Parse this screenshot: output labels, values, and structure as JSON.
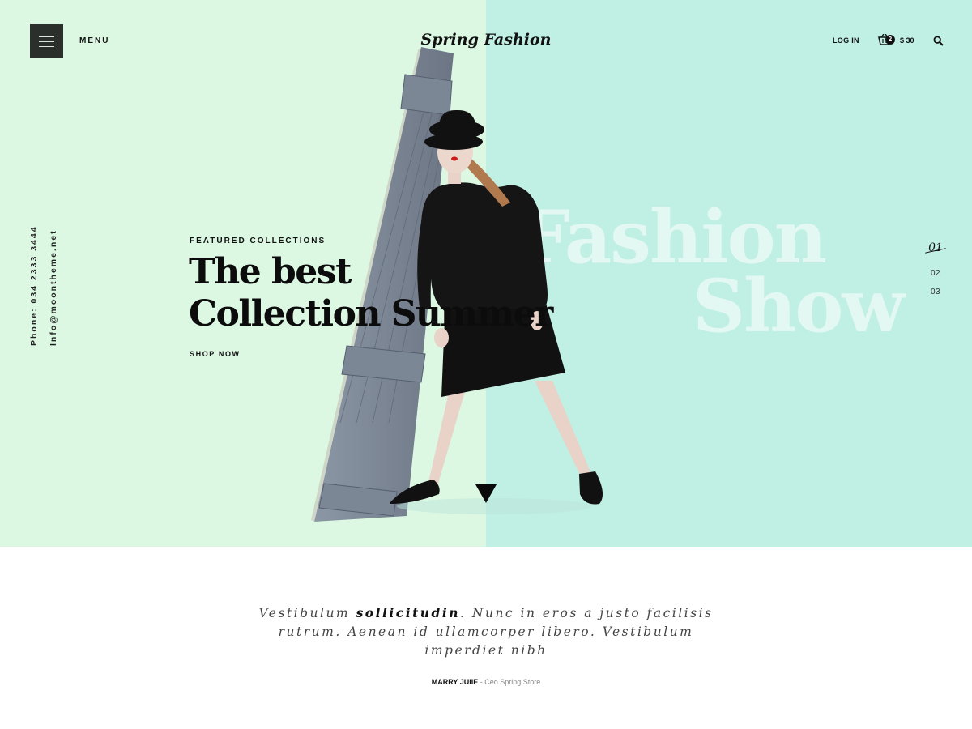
{
  "header": {
    "menu_label": "MENU",
    "logo": "Spring Fashion",
    "login_label": "LOG IN",
    "cart_count": "2",
    "cart_total": "$ 30"
  },
  "contact": {
    "phone": "Phone: 034 2333 3444",
    "email": "Info@moontheme.net"
  },
  "hero": {
    "eyebrow": "FEATURED COLLECTIONS",
    "headline_line1": "The best",
    "headline_line2": "Collection Summer",
    "cta": "SHOP NOW",
    "watermark_line1": "Fashion",
    "watermark_line2": "Show",
    "colors": {
      "left_bg": "#dcf8e3",
      "right_bg": "#c0efe4"
    }
  },
  "slides": {
    "active": "01",
    "items": [
      "02",
      "03"
    ]
  },
  "quote": {
    "part1": "Vestibulum ",
    "emphasis": "sollicitudin",
    "part2": ". Nunc in eros a justo facilisis rutrum. Aenean id ullamcorper libero. Vestibulum imperdiet nibh"
  },
  "author": {
    "name": "MARRY JUIIE",
    "role": " - Ceo Spring Store"
  },
  "icons": {
    "menu": "hamburger-icon",
    "cart": "basket-icon",
    "search": "search-icon",
    "scroll": "triangle-down-icon"
  }
}
